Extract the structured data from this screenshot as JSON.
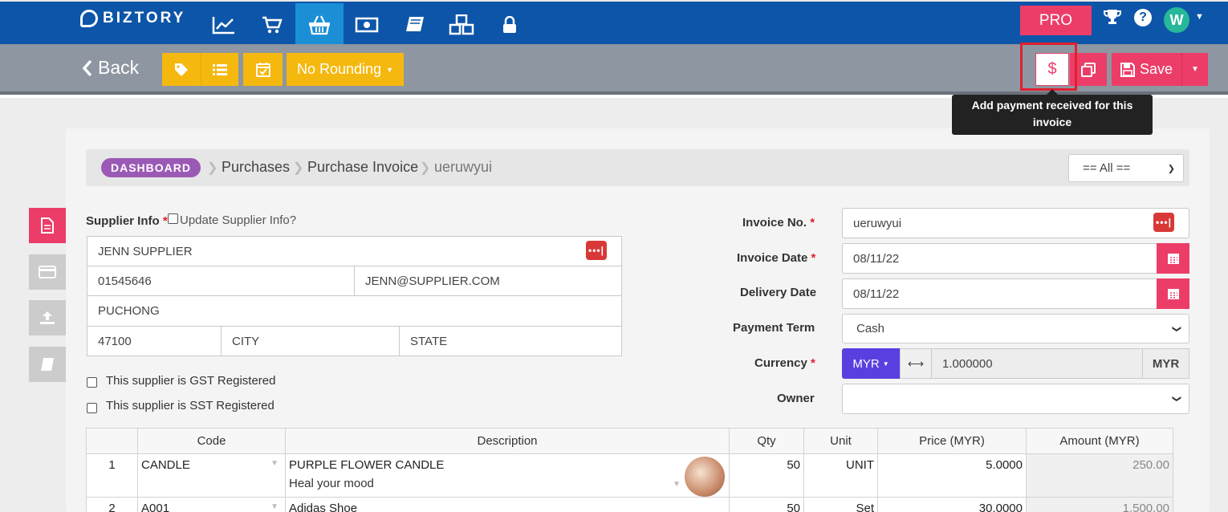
{
  "app": {
    "brand": "BIZTORY"
  },
  "topnav": {
    "icons": [
      "chart-icon",
      "cart-icon",
      "basket-icon",
      "money-icon",
      "book-icon",
      "boxes-icon",
      "lock-icon"
    ],
    "active_icon": "basket-icon",
    "pro_label": "PRO",
    "avatar_letter": "W"
  },
  "actionbar": {
    "back_label": "Back",
    "rounding_label": "No Rounding",
    "save_label": "Save",
    "tooltip": "Add payment received for this invoice"
  },
  "breadcrumb": {
    "dashboard": "DASHBOARD",
    "items": [
      "Purchases",
      "Purchase Invoice",
      "ueruwyui"
    ],
    "filter_value": "== All =="
  },
  "supplier": {
    "label": "Supplier Info",
    "update_label": "Update Supplier Info?",
    "name": "JENN SUPPLIER",
    "phone": "01545646",
    "email": "JENN@SUPPLIER.COM",
    "address": "PUCHONG",
    "postcode": "47100",
    "city_placeholder": "CITY",
    "state_placeholder": "STATE",
    "gst_label": "This supplier is GST Registered",
    "sst_label": "This supplier is SST Registered"
  },
  "invoice": {
    "no_label": "Invoice No.",
    "no_value": "ueruwyui",
    "date_label": "Invoice Date",
    "date_value": "08/11/22",
    "delivery_label": "Delivery Date",
    "delivery_value": "08/11/22",
    "term_label": "Payment Term",
    "term_value": "Cash",
    "currency_label": "Currency",
    "currency_value": "MYR",
    "rate_value": "1.000000",
    "base_currency": "MYR",
    "owner_label": "Owner",
    "owner_value": ""
  },
  "table": {
    "headers": [
      "",
      "Code",
      "Description",
      "Qty",
      "Unit",
      "Price (MYR)",
      "Amount (MYR)"
    ],
    "rows": [
      {
        "no": "1",
        "code": "CANDLE",
        "desc": "PURPLE FLOWER CANDLE",
        "desc2": "Heal your mood",
        "qty": "50",
        "unit": "UNIT",
        "price": "5.0000",
        "amount": "250.00"
      },
      {
        "no": "2",
        "code": "A001",
        "desc": "Adidas Shoe",
        "desc2": "",
        "qty": "50",
        "unit": "Set",
        "price": "30.0000",
        "amount": "1,500.00"
      }
    ]
  },
  "colors": {
    "nav": "#0d55a8",
    "accent": "#ec3d68",
    "warning": "#f5b80e",
    "purple": "#9b59b6"
  }
}
